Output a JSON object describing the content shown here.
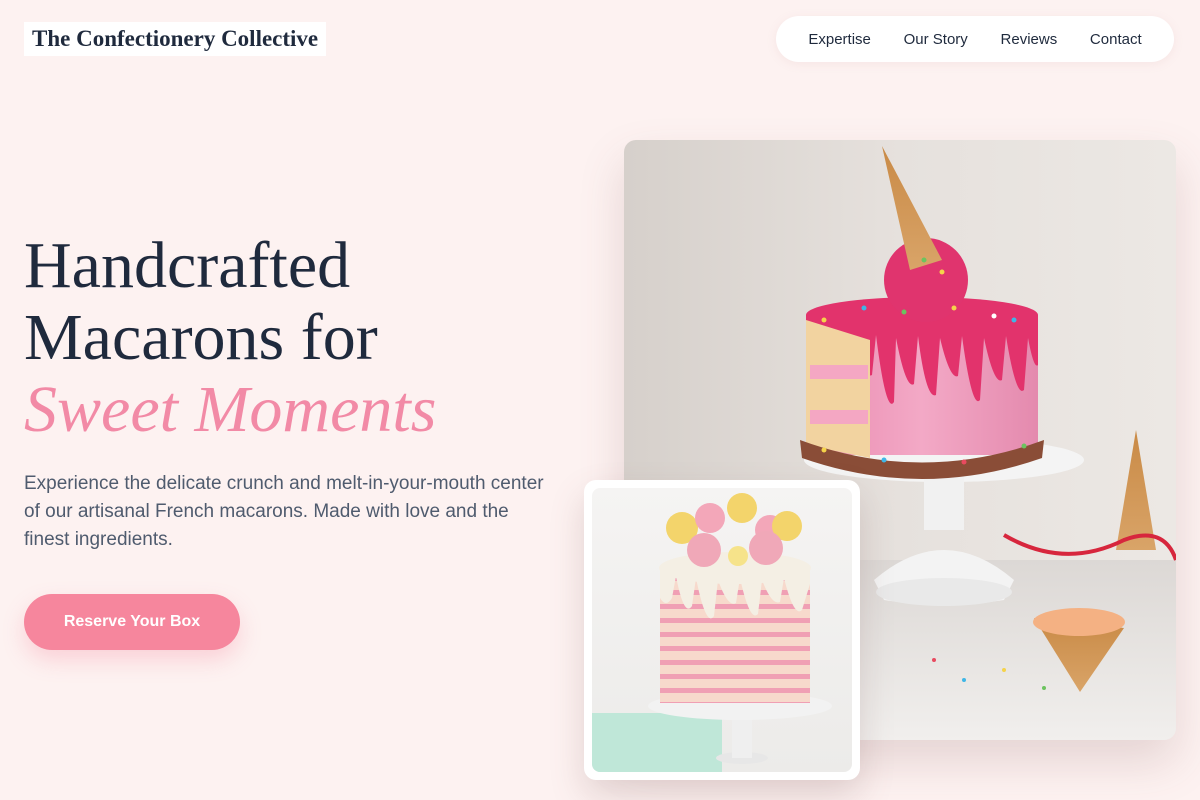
{
  "brand": {
    "name": "The Confectionery Collective"
  },
  "nav": {
    "items": [
      {
        "label": "Expertise"
      },
      {
        "label": "Our Story"
      },
      {
        "label": "Reviews"
      },
      {
        "label": "Contact"
      }
    ]
  },
  "hero": {
    "headline_line1": "Handcrafted",
    "headline_line2": "Macarons for",
    "headline_accent": "Sweet Moments",
    "description": "Experience the delicate crunch and melt-in-your-mouth center of our artisanal French macarons. Made with love and the finest ingredients.",
    "cta_label": "Reserve Your Box"
  },
  "colors": {
    "background": "#fdf2f1",
    "accent": "#f28aa6",
    "button": "#f6869d",
    "text_dark": "#1f2a3d",
    "text_muted": "#4f5b6e"
  },
  "images": {
    "main": "cake-drip-sprinkles-ice-cream-cone-photo",
    "secondary": "striped-cake-macaron-topping-photo"
  }
}
